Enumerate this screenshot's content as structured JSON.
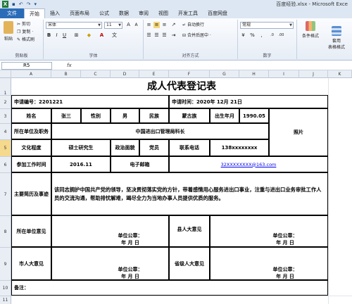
{
  "window": {
    "title": "百度经验.xlsx - Microsoft Exce"
  },
  "ribbon": {
    "tabs": [
      "文件",
      "开始",
      "插入",
      "页面布局",
      "公式",
      "数据",
      "审阅",
      "视图",
      "开发工具",
      "百度网盘"
    ],
    "clipboard": {
      "paste": "粘贴",
      "cut": "剪切",
      "copy": "复制 ·",
      "painter": "格式刷",
      "label": "剪贴板"
    },
    "font": {
      "name": "宋体",
      "size": "11",
      "label": "字体"
    },
    "alignment": {
      "wrap": "自动换行",
      "merge": "合并后居中 ·",
      "label": "对齐方式"
    },
    "number": {
      "format": "常规",
      "label": "数字"
    },
    "styles": {
      "conditional": "条件格式",
      "table": "套用\n表格格式"
    }
  },
  "formula_bar": {
    "name_box": "R5",
    "fx": "fx",
    "content": ""
  },
  "columns": [
    "A",
    "B",
    "C",
    "D",
    "E",
    "F",
    "G",
    "H",
    "I",
    "J",
    "K"
  ],
  "rows": [
    "1",
    "2",
    "3",
    "4",
    "5",
    "6",
    "7",
    "8",
    "9",
    "10",
    "11"
  ],
  "form": {
    "title": "成人代表登记表",
    "app_no_label": "申请编号：2201221",
    "app_time_label": "申请时间：2020年 12月 21日",
    "name_label": "姓名",
    "name_value": "张三",
    "gender_label": "性别",
    "gender_value": "男",
    "ethnic_label": "民族",
    "ethnic_value": "蒙古族",
    "birth_label": "出生年月",
    "birth_value": "1990.05",
    "photo_label": "照片",
    "unit_label": "所在单位及职务",
    "unit_value": "中国进出口管理局科长",
    "edu_label": "文化程度",
    "edu_value": "硕士研究生",
    "political_label": "政治面貌",
    "political_value": "党员",
    "phone_label": "联系电话",
    "phone_value": "138xxxxxxxx",
    "work_time_label": "参加工作时间",
    "work_time_value": "2016.11",
    "email_label": "电子邮箱",
    "email_value": "32XXXXXXXX@163.com",
    "resume_label": "主要简历及事迹",
    "resume_value": "该同志拥护中国共产党的领导，坚决贯彻落实党的方针，带着感情用心服务进出口事业，注重与进出口业务审批工作人员的交流沟通，帮助排忧解难，竭尽全力为当地办事人员提供优质的服务。",
    "unit_opinion_label": "所在单位意见",
    "county_opinion_label": "县人大意见",
    "city_opinion_label": "市人大意见",
    "province_opinion_label": "省级人大意见",
    "seal_label": "单位公章：",
    "date_label": "年    月    日",
    "remark_label": "备注："
  }
}
